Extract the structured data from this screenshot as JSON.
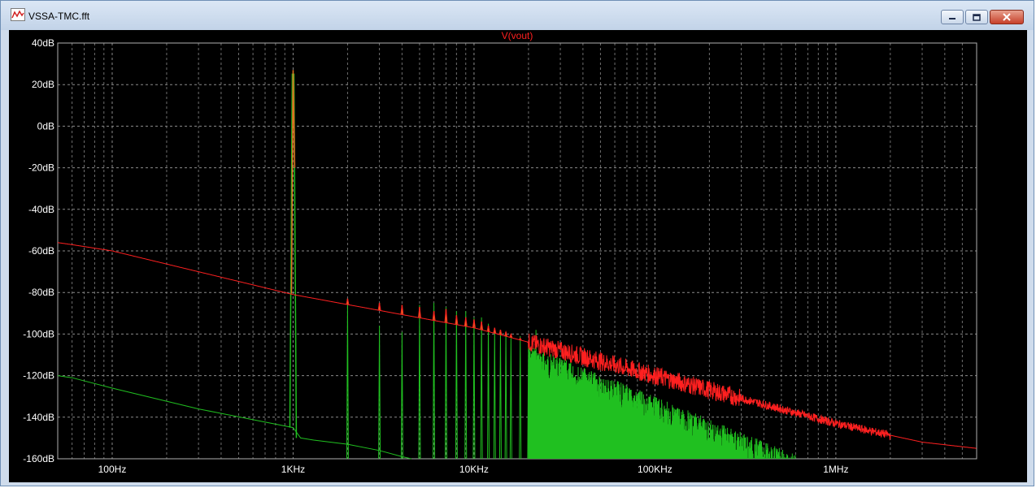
{
  "window": {
    "title": "VSSA-TMC.fft",
    "icon": "waveform-icon",
    "controls": [
      {
        "name": "minimize-icon"
      },
      {
        "name": "maximize-icon"
      },
      {
        "name": "close-icon"
      }
    ]
  },
  "colors": {
    "background": "#000000",
    "grid": "#8a8a8a",
    "trace_red": "#ff2020",
    "trace_green": "#20c020",
    "trace_orange": "#e07020",
    "text": "#ffffff"
  },
  "chart_data": {
    "type": "line",
    "title": "V(vout)",
    "xscale": "log",
    "xlim": [
      50,
      6000000
    ],
    "ylim": [
      -160,
      40
    ],
    "grid": true,
    "xticks": [
      {
        "value": 100,
        "label": "100Hz"
      },
      {
        "value": 1000,
        "label": "1KHz"
      },
      {
        "value": 10000,
        "label": "10KHz"
      },
      {
        "value": 100000,
        "label": "100KHz"
      },
      {
        "value": 1000000,
        "label": "1MHz"
      }
    ],
    "yticks": [
      {
        "value": 40,
        "label": "40dB"
      },
      {
        "value": 20,
        "label": "20dB"
      },
      {
        "value": 0,
        "label": "0dB"
      },
      {
        "value": -20,
        "label": "-20dB"
      },
      {
        "value": -40,
        "label": "-40dB"
      },
      {
        "value": -60,
        "label": "-60dB"
      },
      {
        "value": -80,
        "label": "-80dB"
      },
      {
        "value": -100,
        "label": "-100dB"
      },
      {
        "value": -120,
        "label": "-120dB"
      },
      {
        "value": -140,
        "label": "-140dB"
      },
      {
        "value": -160,
        "label": "-160dB"
      }
    ],
    "series": [
      {
        "color": "#ff2020",
        "floor": [
          [
            50,
            -56
          ],
          [
            60,
            -57
          ],
          [
            100,
            -60
          ],
          [
            1000,
            -81
          ],
          [
            10000,
            -97
          ],
          [
            100000,
            -120
          ],
          [
            1000000,
            -143
          ],
          [
            3000000,
            -152
          ],
          [
            6000000,
            -155
          ]
        ],
        "fundamental": {
          "x": 1000,
          "peak_db": 27
        },
        "harmonic_peaks": [
          [
            2000,
            -83
          ],
          [
            3000,
            -85
          ],
          [
            4000,
            -86
          ],
          [
            5000,
            -87
          ],
          [
            6000,
            -89
          ],
          [
            7000,
            -88
          ],
          [
            8000,
            -91
          ],
          [
            9000,
            -92
          ],
          [
            10000,
            -93
          ],
          [
            11000,
            -94
          ],
          [
            12000,
            -96
          ],
          [
            13000,
            -97
          ],
          [
            14000,
            -98
          ],
          [
            15000,
            -99
          ],
          [
            16000,
            -100
          ],
          [
            18000,
            -102
          ],
          [
            20000,
            -104
          ],
          [
            22000,
            -106
          ]
        ]
      },
      {
        "color": "#20c020",
        "floor": [
          [
            50,
            -120
          ],
          [
            60,
            -121
          ],
          [
            100,
            -126
          ],
          [
            300,
            -136
          ],
          [
            1000,
            -145
          ],
          [
            1100,
            -150
          ],
          [
            1300,
            -151
          ],
          [
            2000,
            -153
          ],
          [
            3000,
            -156
          ],
          [
            4000,
            -159
          ],
          [
            4500,
            -160
          ]
        ],
        "fundamental": {
          "x": 1000,
          "peak_db": 25
        },
        "harmonic_peaks": [
          [
            2000,
            -86
          ],
          [
            3000,
            -96
          ],
          [
            4000,
            -99
          ],
          [
            5000,
            -86
          ],
          [
            6000,
            -85
          ],
          [
            7000,
            -87
          ],
          [
            8000,
            -89
          ],
          [
            9000,
            -89
          ],
          [
            10000,
            -92
          ],
          [
            11000,
            -92
          ],
          [
            12000,
            -95
          ],
          [
            13000,
            -98
          ],
          [
            14000,
            -99
          ],
          [
            15000,
            -99
          ],
          [
            16000,
            -102
          ],
          [
            18000,
            -101
          ],
          [
            20000,
            -104
          ],
          [
            22000,
            -98
          ]
        ],
        "dense_band": {
          "x_start": 20000,
          "x_end": 600000,
          "top_start_db": -105,
          "top_end_db": -158
        }
      }
    ]
  }
}
